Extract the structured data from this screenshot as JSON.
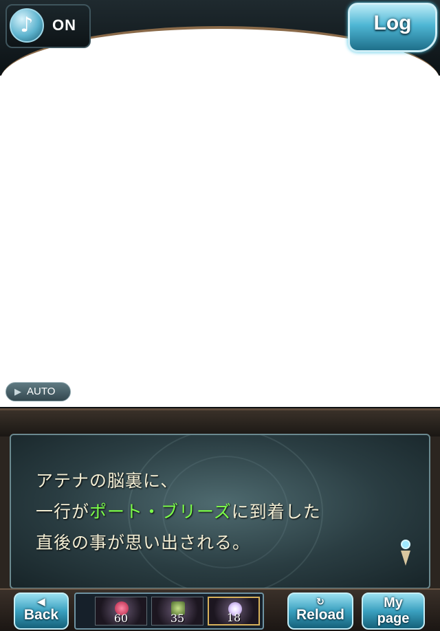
{
  "top_bar": {
    "sound_toggle": {
      "icon": "music-note-icon",
      "label": "ON"
    },
    "log_button": {
      "label": "Log"
    }
  },
  "auto_button": {
    "icon": "play-triangle-icon",
    "label": "AUTO"
  },
  "message": {
    "line1": "アテナの脳裏に、",
    "line2_before": "一行が",
    "line2_highlight": "ポート・ブリーズ",
    "line2_after": "に到着した",
    "line3": "直後の事が思い出される。",
    "highlight_color": "#7dff4a"
  },
  "bottom_bar": {
    "back": {
      "icon": "back-arrow-icon",
      "label": "Back"
    },
    "items": [
      {
        "icon": "red-orb-icon",
        "count": "60"
      },
      {
        "icon": "green-cube-icon",
        "count": "35"
      },
      {
        "icon": "white-crystal-icon",
        "count": "18"
      }
    ],
    "reload": {
      "icon": "reload-icon",
      "label": "Reload"
    },
    "mypage": {
      "label_line1": "My",
      "label_line2": "page"
    }
  }
}
